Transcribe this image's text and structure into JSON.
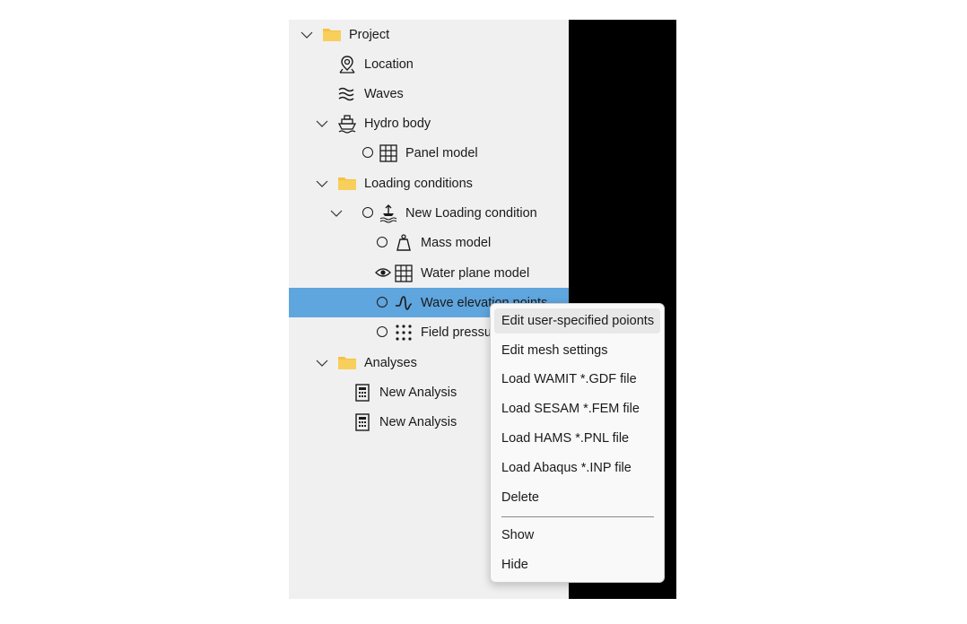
{
  "tree": {
    "project": "Project",
    "location": "Location",
    "waves": "Waves",
    "hydro_body": "Hydro body",
    "panel_model": "Panel model",
    "loading_conditions": "Loading conditions",
    "new_loading_condition": "New Loading condition",
    "mass_model": "Mass model",
    "water_plane_model": "Water plane model",
    "wave_elevation": "Wave elevati",
    "wave_elevation_tail": "on points",
    "field_pressure": "Field pressu",
    "analyses": "Analyses",
    "new_analysis_1": "New Analysis",
    "new_analysis_2": "New Analysis"
  },
  "context_menu": {
    "edit_points": "Edit user-specified poionts",
    "edit_mesh": "Edit mesh settings",
    "load_wamit": "Load WAMIT *.GDF file",
    "load_sesam": "Load SESAM *.FEM file",
    "load_hams": "Load HAMS *.PNL file",
    "load_abaqus": "Load Abaqus *.INP file",
    "delete": "Delete",
    "show": "Show",
    "hide": "Hide"
  },
  "colors": {
    "selection": "#5fa5de",
    "folder": "#f5c242",
    "panel_bg": "#f0f0f0",
    "menu_bg": "#f9f9f9"
  },
  "icons": {
    "folder": "folder-icon",
    "location": "map-pin-icon",
    "waves": "waves-icon",
    "ship": "ship-icon",
    "grid": "grid-icon",
    "loading": "loading-condition-icon",
    "mass": "weight-icon",
    "eye": "eye-icon",
    "wave_signal": "wave-signal-icon",
    "dots": "dot-grid-icon",
    "calculator": "calculator-icon",
    "chevron": "chevron-down-icon"
  }
}
